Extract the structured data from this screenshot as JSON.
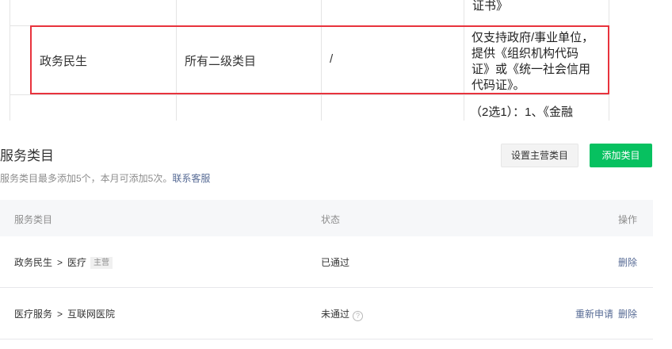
{
  "req_table": {
    "top_fragment": "证书》",
    "row": {
      "category": "政务民生",
      "sub_category": "所有二级类目",
      "qualification": "/",
      "requirement_lines": [
        "仅支持政府/事业单位，",
        "提供《组织机构代码",
        "证》或《统一社会信用",
        "代码证》。"
      ]
    },
    "next_row_fragment": "（2选1）：1、《金融"
  },
  "service": {
    "title": "服务类目",
    "desc_prefix": "服务类目最多添加5个，本月可添加5次。",
    "contact_link": "联系客服",
    "btn_set_main": "设置主营类目",
    "btn_add": "添加类目",
    "headers": {
      "category": "服务类目",
      "status": "状态",
      "action": "操作"
    },
    "rows": [
      {
        "level1": "政务民生",
        "arrow": ">",
        "level2": "医疗",
        "tag": "主营",
        "status": "已通过",
        "actions": [
          "删除"
        ]
      },
      {
        "level1": "医疗服务",
        "arrow": ">",
        "level2": "互联网医院",
        "status": "未通过",
        "help_icon": "question-circle-icon",
        "actions": [
          "重新申请",
          "删除"
        ]
      }
    ]
  },
  "colors": {
    "accent_green": "#07c160",
    "link_blue": "#576b95",
    "highlight_red": "#e8333d"
  }
}
